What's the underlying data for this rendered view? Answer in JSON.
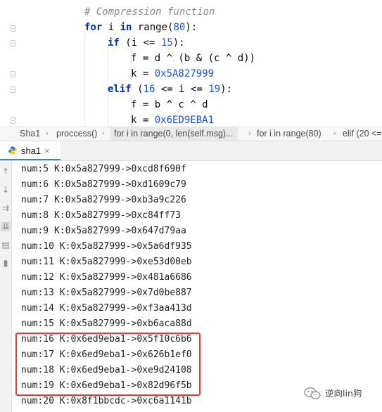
{
  "editor": {
    "lines": [
      {
        "parts": [
          {
            "t": "# Compression function",
            "c": "cm"
          }
        ]
      },
      {
        "parts": [
          {
            "t": "for ",
            "c": "kw"
          },
          {
            "t": "i ",
            "c": ""
          },
          {
            "t": "in ",
            "c": "kw"
          },
          {
            "t": "range(",
            "c": ""
          },
          {
            "t": "80",
            "c": "num"
          },
          {
            "t": "):",
            "c": ""
          }
        ]
      },
      {
        "parts": [
          {
            "t": "if ",
            "c": "kw"
          },
          {
            "t": "(i <= ",
            "c": ""
          },
          {
            "t": "15",
            "c": "num"
          },
          {
            "t": "):",
            "c": ""
          }
        ]
      },
      {
        "parts": [
          {
            "t": "f = d ^ (b & (c ^ d))",
            "c": ""
          }
        ]
      },
      {
        "parts": [
          {
            "t": "k = ",
            "c": ""
          },
          {
            "t": "0x5A827999",
            "c": "num"
          }
        ]
      },
      {
        "parts": [
          {
            "t": "elif ",
            "c": "kw"
          },
          {
            "t": "(",
            "c": ""
          },
          {
            "t": "16",
            "c": "num"
          },
          {
            "t": " <= i <= ",
            "c": ""
          },
          {
            "t": "19",
            "c": "num"
          },
          {
            "t": "):",
            "c": ""
          }
        ]
      },
      {
        "parts": [
          {
            "t": "f = b ^ c ^ d",
            "c": ""
          }
        ]
      },
      {
        "parts": [
          {
            "t": "k = ",
            "c": ""
          },
          {
            "t": "0x6ED9EBA1",
            "c": "num"
          }
        ]
      }
    ]
  },
  "breadcrumb": {
    "items": [
      "Sha1",
      "proccess()",
      "for i in range(0, len(self.msg)...",
      "for i in range(80)",
      "elif (20 <="
    ],
    "separator": "›"
  },
  "run_tab": {
    "label": "sha1",
    "close": "×",
    "icon": "python-icon"
  },
  "toolbar_icons": [
    "arrow-up-icon",
    "arrow-down-icon",
    "soft-wrap-icon",
    "scroll-to-end-icon",
    "print-icon",
    "trash-icon"
  ],
  "console": {
    "lines": [
      "num:5 K:0x5a827999->0xcd8f690f",
      "num:6 K:0x5a827999->0xd1609c79",
      "num:7 K:0x5a827999->0xb3a9c226",
      "num:8 K:0x5a827999->0xc84ff73",
      "num:9 K:0x5a827999->0x647d79aa",
      "num:10 K:0x5a827999->0x5a6df935",
      "num:11 K:0x5a827999->0xe53d00eb",
      "num:12 K:0x5a827999->0x481a6686",
      "num:13 K:0x5a827999->0x7d0be887",
      "num:14 K:0x5a827999->0xf3aa413d",
      "num:15 K:0x5a827999->0xb6aca88d",
      "num:16 K:0x6ed9eba1->0x5f10c6b6",
      "num:17 K:0x6ed9eba1->0x626b1ef0",
      "num:18 K:0x6ed9eba1->0xe9d24108",
      "num:19 K:0x6ed9eba1->0x82d96f5b",
      "num:20 K:0x8f1bbcdc->0xc6a1141b"
    ]
  },
  "watermark": {
    "text": "逆向lin狗"
  },
  "colors": {
    "highlight_box": "#e53935",
    "keyword": "#0033b3",
    "number": "#1750eb",
    "comment": "#8c8c8c",
    "tab_underline": "#4083c9"
  }
}
